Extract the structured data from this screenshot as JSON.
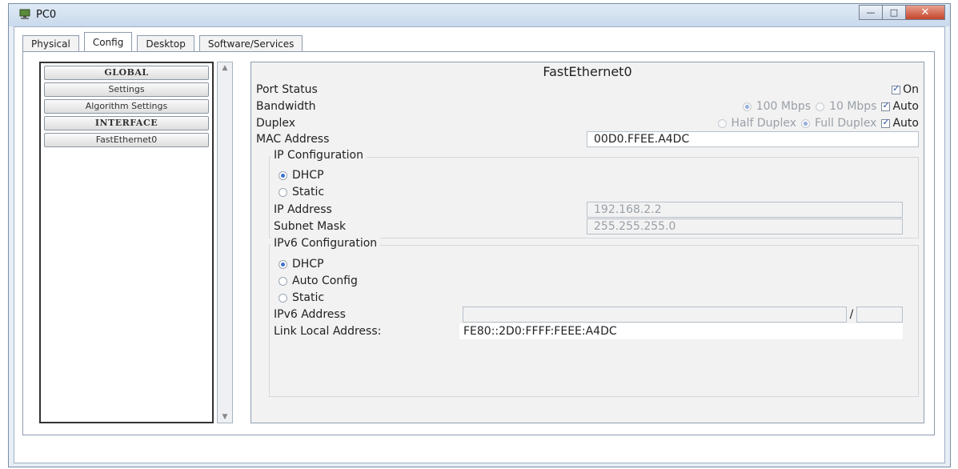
{
  "window": {
    "title": "PC0",
    "buttons": {
      "minimize": "—",
      "maximize": "□",
      "close": "✕"
    }
  },
  "tabs": [
    {
      "label": "Physical",
      "active": false
    },
    {
      "label": "Config",
      "active": true
    },
    {
      "label": "Desktop",
      "active": false
    },
    {
      "label": "Software/Services",
      "active": false
    }
  ],
  "sidebar": {
    "items": [
      {
        "label": "GLOBAL",
        "type": "header"
      },
      {
        "label": "Settings",
        "type": "item"
      },
      {
        "label": "Algorithm Settings",
        "type": "item"
      },
      {
        "label": "INTERFACE",
        "type": "header"
      },
      {
        "label": "FastEthernet0",
        "type": "item"
      }
    ],
    "scroll_up": "▲",
    "scroll_down": "▼"
  },
  "interface": {
    "title": "FastEthernet0",
    "port_status": {
      "label": "Port Status",
      "on_label": "On",
      "on_checked": true
    },
    "bandwidth": {
      "label": "Bandwidth",
      "opt_100": "100 Mbps",
      "opt_10": "10 Mbps",
      "auto_label": "Auto",
      "auto_checked": true
    },
    "duplex": {
      "label": "Duplex",
      "opt_half": "Half Duplex",
      "opt_full": "Full Duplex",
      "auto_label": "Auto",
      "auto_checked": true
    },
    "mac": {
      "label": "MAC Address",
      "value": "00D0.FFEE.A4DC"
    },
    "ip_config": {
      "title": "IP Configuration",
      "dhcp_label": "DHCP",
      "static_label": "Static",
      "mode": "DHCP",
      "ip_label": "IP Address",
      "ip_value": "192.168.2.2",
      "mask_label": "Subnet Mask",
      "mask_value": "255.255.255.0"
    },
    "ipv6_config": {
      "title": "IPv6 Configuration",
      "dhcp_label": "DHCP",
      "auto_label": "Auto Config",
      "static_label": "Static",
      "mode": "DHCP",
      "addr_label": "IPv6 Address",
      "addr_value": "",
      "prefix_value": "",
      "prefix_sep": "/",
      "link_local_label": "Link Local Address:",
      "link_local_value": "FE80::2D0:FFFF:FEEE:A4DC"
    }
  },
  "colors": {
    "accent": "#3b6fd0",
    "titlebar": "#c9d9ec",
    "close_button": "#c4452b"
  }
}
